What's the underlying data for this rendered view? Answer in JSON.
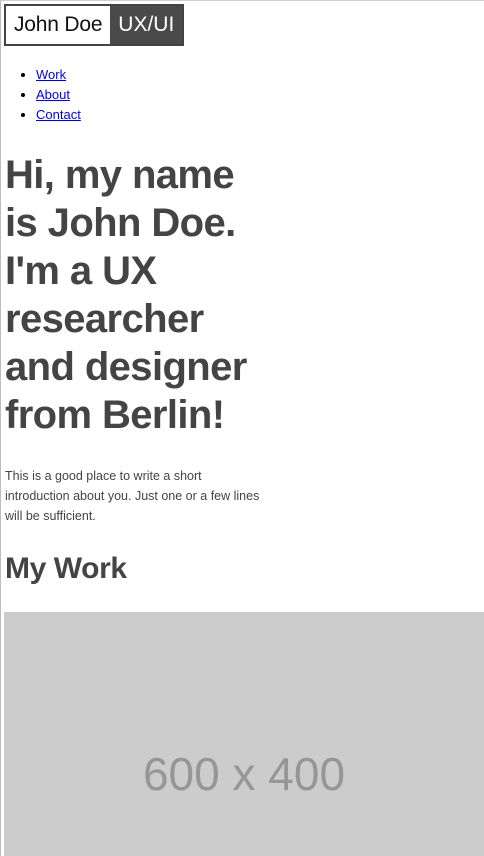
{
  "logo": {
    "name": "John Doe",
    "role": "UX/UI"
  },
  "nav": {
    "items": [
      {
        "label": "Work"
      },
      {
        "label": "About"
      },
      {
        "label": "Contact"
      }
    ]
  },
  "hero": {
    "title": "Hi, my name is John Doe. I'm a UX researcher and designer from Berlin!",
    "intro": "This is a good place to write a short introduction about you. Just one or a few lines will be sufficient."
  },
  "work": {
    "title": "My Work",
    "placeholder_label": "600 x 400"
  },
  "colors": {
    "text": "#444444",
    "link": "#0000ee",
    "placeholder_bg": "#cccccc",
    "placeholder_text": "#969696",
    "logo_role_bg": "#4a4a4a"
  }
}
